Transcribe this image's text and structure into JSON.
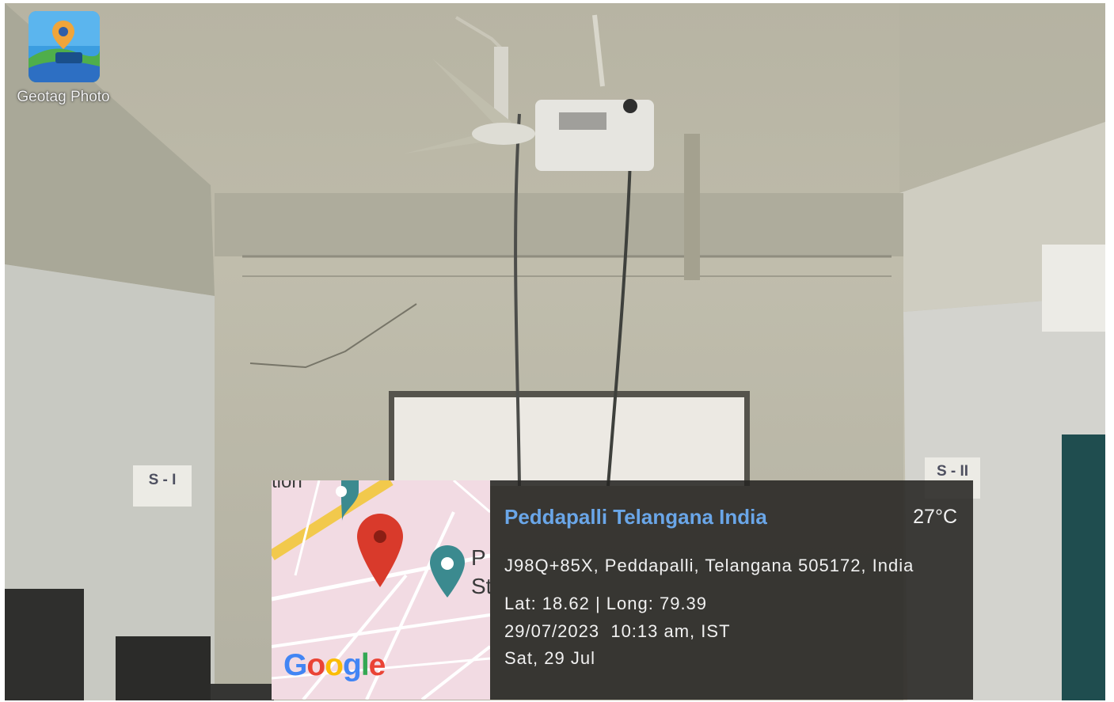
{
  "app": {
    "name": "Geotag Photo",
    "icon": "geotag-photo-app-icon"
  },
  "wall_signs": {
    "left": "S - I",
    "right": "S - II"
  },
  "map": {
    "partial_label_top": "tion",
    "partial_label_right_1": "P",
    "partial_label_right_2": "St",
    "logo": {
      "text": "Google",
      "letters": [
        "G",
        "o",
        "o",
        "g",
        "l",
        "e"
      ],
      "colors": [
        "#4285f4",
        "#ea4335",
        "#fbbc05",
        "#4285f4",
        "#34a853",
        "#ea4335"
      ]
    },
    "marker_colors": {
      "main": "#d93a2b",
      "poi": "#3b8a8f"
    }
  },
  "geotag": {
    "place": "Peddapalli Telangana India",
    "temperature": "27°C",
    "address": "J98Q+85X, Peddapalli, Telangana 505172, India",
    "coordinates": "Lat: 18.62 | Long: 79.39",
    "datetime": "29/07/2023  10:13 am, IST",
    "day": "Sat, 29 Jul"
  },
  "colors": {
    "title_blue": "#6aa6e8",
    "panel_bg": "#262422",
    "map_bg": "#f2dbe3"
  }
}
